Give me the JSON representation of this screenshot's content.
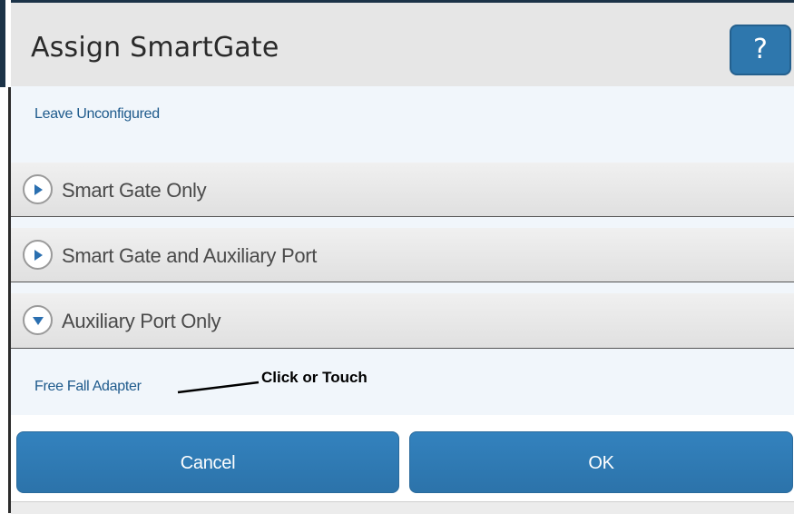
{
  "dialog": {
    "title": "Assign SmartGate",
    "help_label": "?"
  },
  "options": {
    "leave_unconfigured": "Leave Unconfigured",
    "sections": [
      {
        "label": "Smart Gate Only",
        "state": "collapsed",
        "icon": "chevron-right-icon"
      },
      {
        "label": "Smart Gate and Auxiliary Port",
        "state": "collapsed",
        "icon": "chevron-right-icon"
      },
      {
        "label": "Auxiliary Port Only",
        "state": "expanded",
        "icon": "chevron-down-icon"
      }
    ],
    "expanded_item": "Free Fall Adapter"
  },
  "annotation": {
    "callout_text": "Click or Touch"
  },
  "buttons": {
    "cancel_label": "Cancel",
    "ok_label": "OK"
  },
  "colors": {
    "accent": "#2e77ad",
    "link": "#1e5a8c",
    "panel": "#f1f6fb",
    "header": "#e6e6e6"
  }
}
